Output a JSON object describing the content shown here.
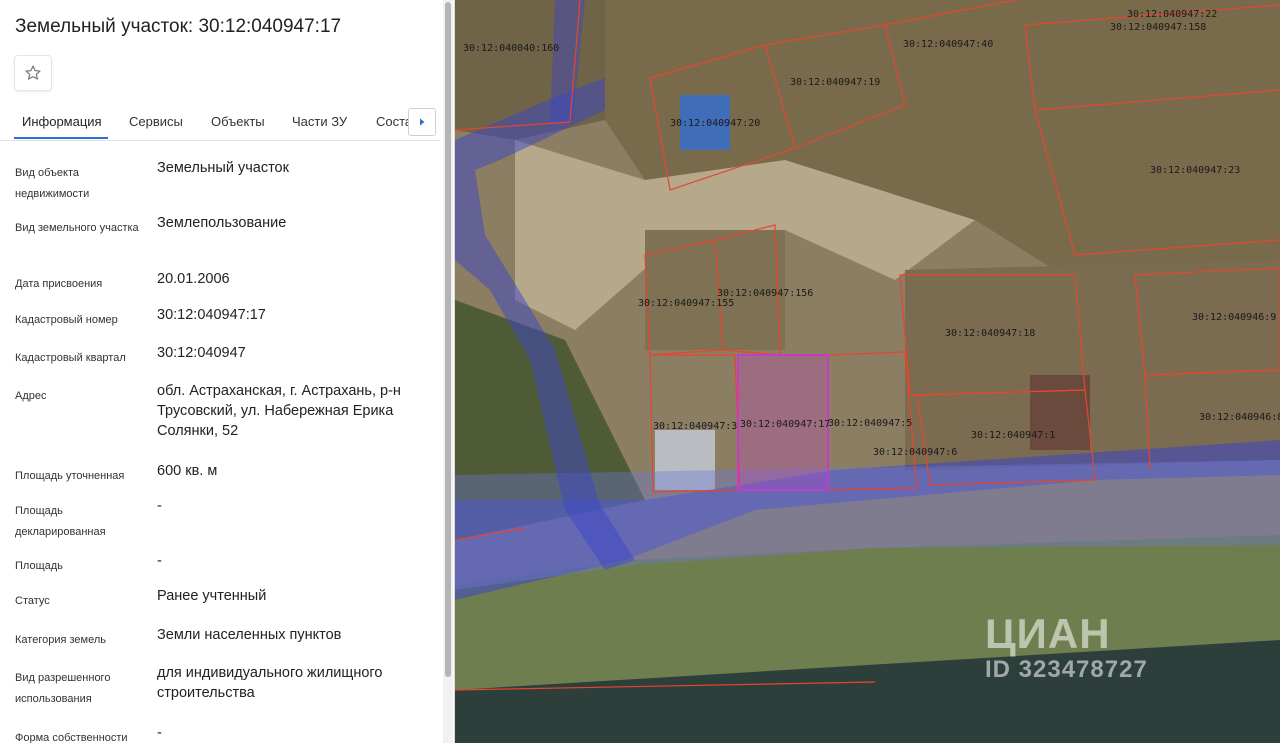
{
  "panel": {
    "title": "Земельный участок: 30:12:040947:17",
    "favorite_icon": "star-outline-icon",
    "tabs": [
      "Информация",
      "Сервисы",
      "Объекты",
      "Части ЗУ",
      "Соста"
    ],
    "tab_scroll_icon": "chevron-right-icon",
    "fields": [
      {
        "label": "Вид объекта недвижимости",
        "value": "Земельный участок"
      },
      {
        "label": "Вид земельного участка",
        "value": "Землепользование"
      },
      {
        "label": "Дата присвоения",
        "value": "20.01.2006"
      },
      {
        "label": "Кадастровый номер",
        "value": "30:12:040947:17"
      },
      {
        "label": "Кадастровый квартал",
        "value": "30:12:040947"
      },
      {
        "label": "Адрес",
        "value": "обл. Астраханская, г. Астрахань, р-н Трусовский, ул. Набережная Ерика Солянки, 52"
      },
      {
        "label": "Площадь уточненная",
        "value": "600 кв. м"
      },
      {
        "label": "Площадь декларированная",
        "value": "-"
      },
      {
        "label": "Площадь",
        "value": "-"
      },
      {
        "label": "Статус",
        "value": "Ранее учтенный"
      },
      {
        "label": "Категория земель",
        "value": "Земли населенных пунктов"
      },
      {
        "label": "Вид разрешенного использования",
        "value": "для индивидуального жилищного строительства"
      },
      {
        "label": "Форма собственности",
        "value": "-"
      }
    ]
  },
  "map": {
    "selected_parcel": "30:12:040947:17",
    "parcel_labels": [
      "30:12:040040:160",
      "30:12:040947:40",
      "30:12:040947:22",
      "30:12:040947:158",
      "30:12:040947:19",
      "30:12:040947:20",
      "30:12:040947:23",
      "30:12:040947:155",
      "30:12:040947:156",
      "30:12:040947:18",
      "30:12:040946:9",
      "30:12:040947:3",
      "30:12:040947:17",
      "30:12:040947:5",
      "30:12:040947:6",
      "30:12:040947:1",
      "30:12:040946:8"
    ],
    "colors": {
      "boundary": "#e8452c",
      "selected": "#c43cc8",
      "zone": "#3c46c8"
    },
    "watermark": {
      "logo": "ЦИАН",
      "id": "ID 323478727"
    }
  }
}
